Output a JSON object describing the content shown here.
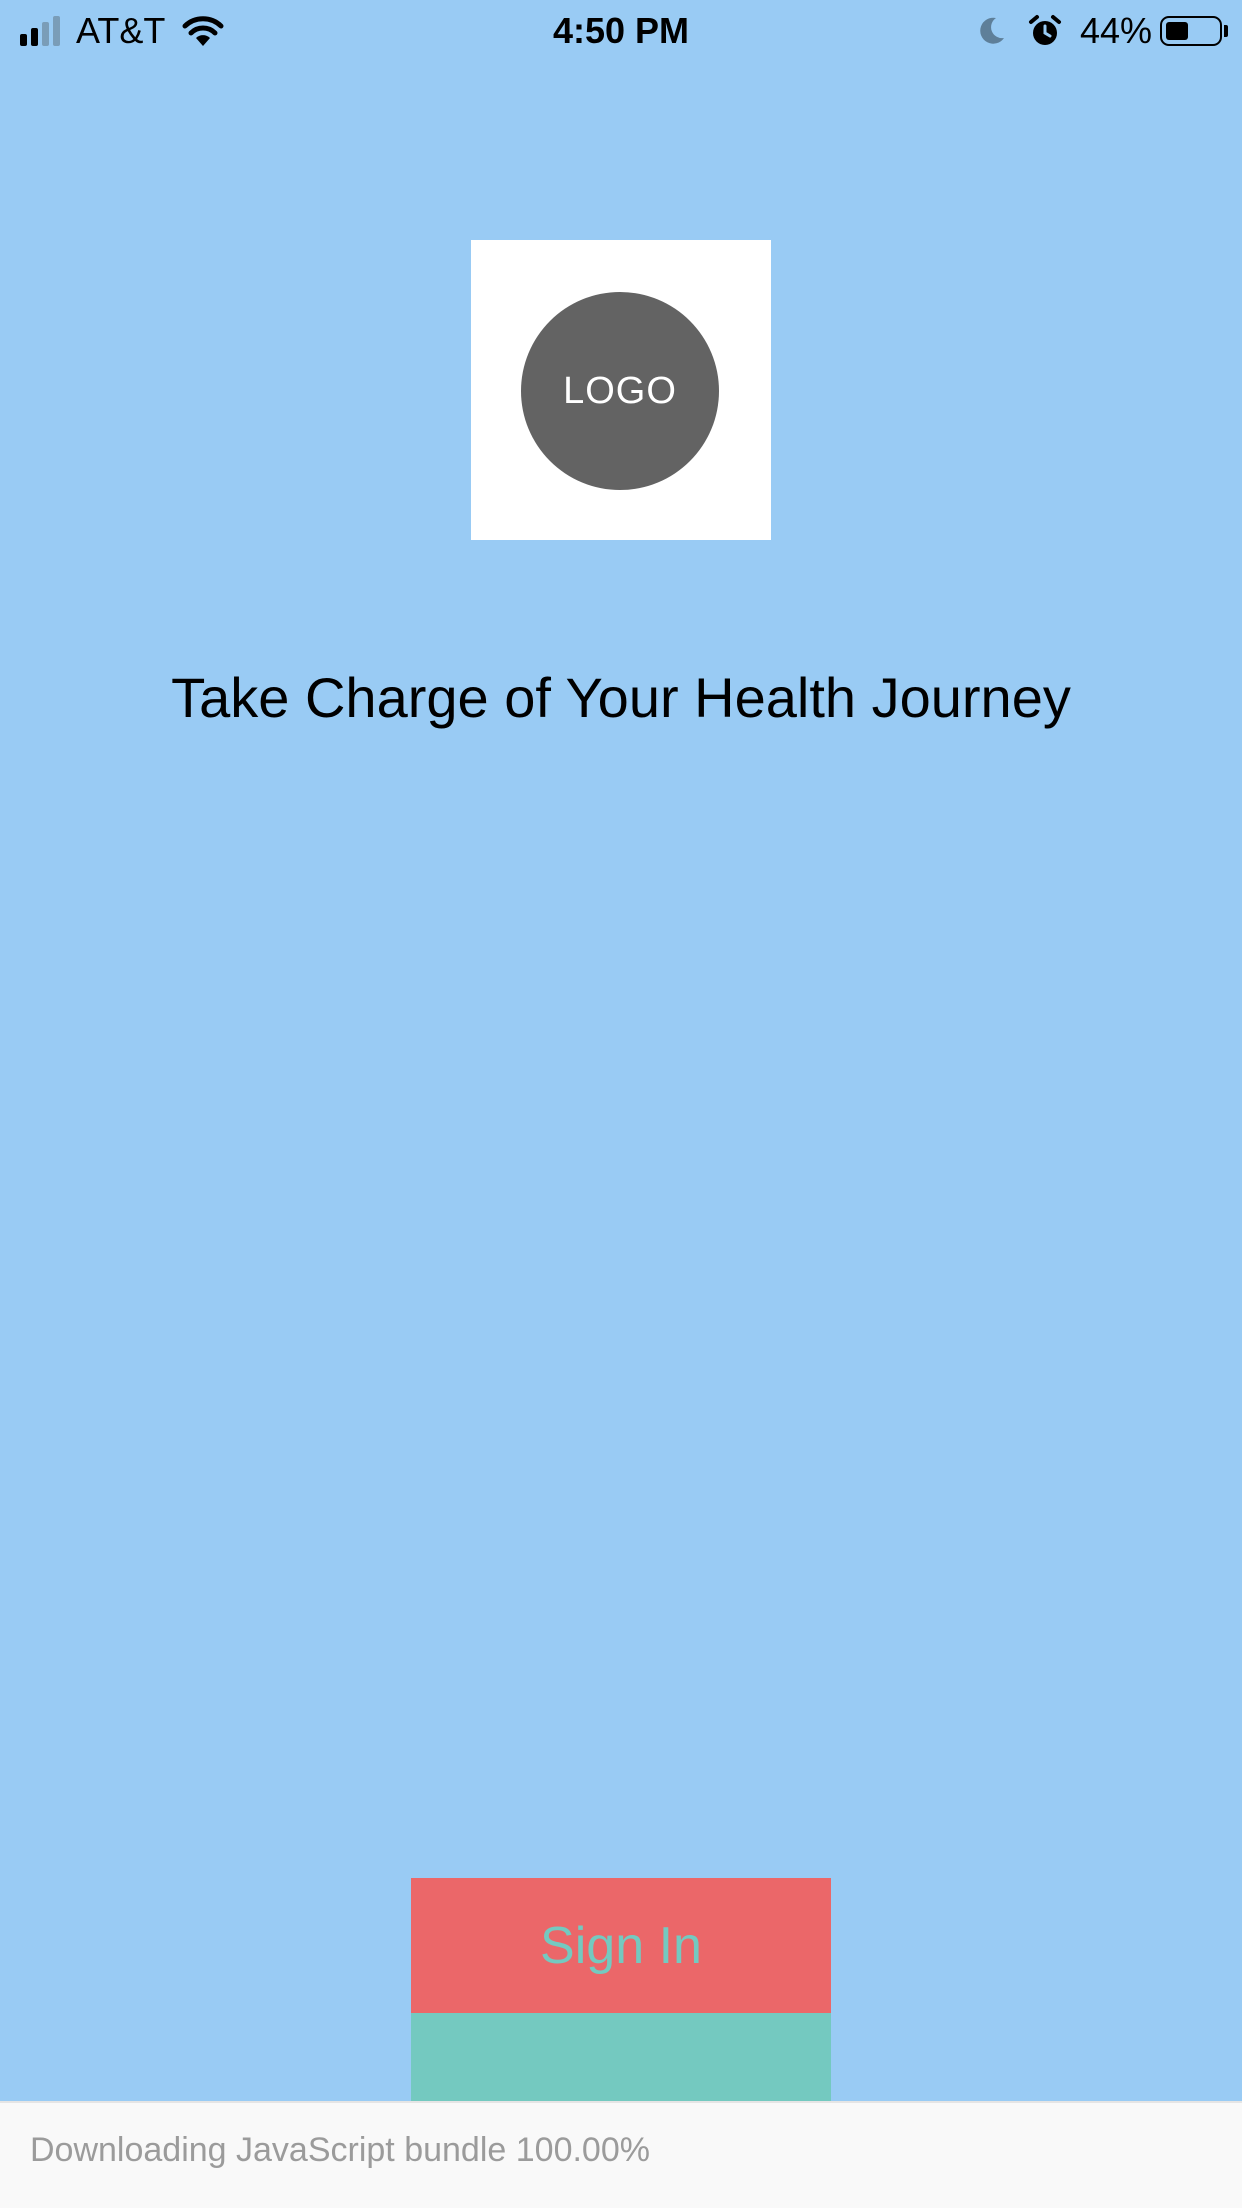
{
  "status_bar": {
    "carrier": "AT&T",
    "time": "4:50 PM",
    "battery_percent": "44%",
    "battery_level": 0.44,
    "signal_bars": 2,
    "icons": [
      "signal-icon",
      "wifi-icon",
      "moon-icon",
      "alarm-icon",
      "battery-icon"
    ]
  },
  "logo": {
    "text": "LOGO"
  },
  "headline": "Take Charge of Your Health Journey",
  "buttons": {
    "sign_in": "Sign In"
  },
  "bundle_status": "Downloading JavaScript bundle 100.00%",
  "colors": {
    "background": "#99cbf4",
    "sign_in_button": "#eb6769",
    "sign_in_text": "#74c9c0",
    "secondary_button": "#74c9c0",
    "logo_circle": "#636363"
  }
}
